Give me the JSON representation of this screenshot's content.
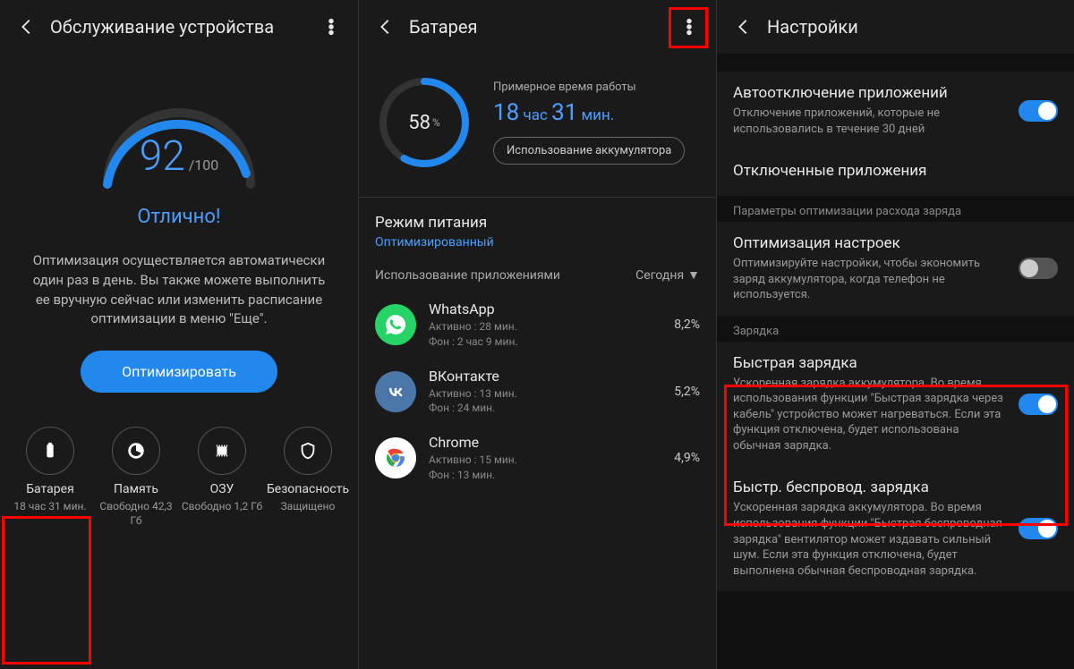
{
  "panel1": {
    "title": "Обслуживание устройства",
    "score": "92",
    "scoreMax": "/100",
    "scoreLabel": "Отлично!",
    "desc": "Оптимизация осуществляется автоматически один раз в день. Вы также можете выполнить ее вручную сейчас или изменить расписание оптимизации в меню \"Еще\".",
    "optimizeBtn": "Оптимизировать",
    "tiles": [
      {
        "title": "Батарея",
        "sub": "18 час 31 мин."
      },
      {
        "title": "Память",
        "sub": "Свободно 42,3 Гб"
      },
      {
        "title": "ОЗУ",
        "sub": "Свободно 1,2 Гб"
      },
      {
        "title": "Безопасность",
        "sub": "Защищено"
      }
    ]
  },
  "panel2": {
    "title": "Батарея",
    "percent": "58",
    "percentUnit": "%",
    "estLabel": "Примерное время работы",
    "estHoursVal": "18",
    "estHoursUnit": "час",
    "estMinsVal": "31",
    "estMinsUnit": "мин.",
    "usageBtn": "Использование аккумулятора",
    "powerModeTitle": "Режим питания",
    "powerModeValue": "Оптимизированный",
    "appsHeader": "Использование приложениями",
    "todayLabel": "Сегодня",
    "apps": [
      {
        "name": "WhatsApp",
        "active": "Активно : 28 мин.",
        "bg": "Фон : 2 час 9 мин.",
        "pct": "8,2%",
        "color": "#25D366"
      },
      {
        "name": "ВКонтакте",
        "active": "Активно : 13 мин.",
        "bg": "Фон : 24 мин.",
        "pct": "5,2%",
        "color": "#4a76a8"
      },
      {
        "name": "Chrome",
        "active": "Активно : 15 мин.",
        "bg": "Фон : 13 мин.",
        "pct": "4,9%",
        "color": "#fff"
      }
    ]
  },
  "panel3": {
    "title": "Настройки",
    "items": {
      "autoDisableTitle": "Автоотключение приложений",
      "autoDisableSub": "Отключение приложений, которые не использовались в течение 30 дней",
      "disabledAppsTitle": "Отключенные приложения",
      "optSectionLabel": "Параметры оптимизации расхода заряда",
      "optSettingsTitle": "Оптимизация настроек",
      "optSettingsSub": "Оптимизируйте настройки, чтобы экономить заряд аккумулятора, когда телефон не используется.",
      "chargingSectionLabel": "Зарядка",
      "fastChargeTitle": "Быстрая зарядка",
      "fastChargeSub": "Ускоренная зарядка аккумулятора. Во время использования функции \"Быстрая зарядка через кабель\" устройство может нагреваться. Если эта функция отключена, будет использована обычная зарядка.",
      "wirelessTitle": "Быстр. беспровод. зарядка",
      "wirelessSub": "Ускоренная зарядка аккумулятора. Во время использования функции \"Быстрая беспроводная зарядка\" вентилятор может издавать сильный шум. Если эта функция отключена, будет выполнена обычная беспроводная зарядка."
    }
  }
}
